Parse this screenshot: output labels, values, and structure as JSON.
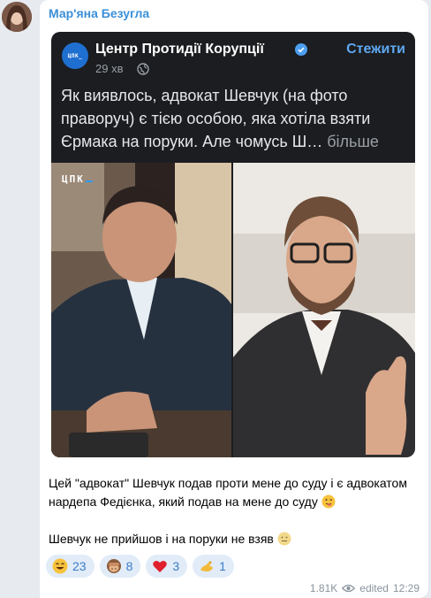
{
  "message": {
    "sender": "Мар'яна Безугла",
    "text_line1": "Цей \"адвокат\" Шевчук подав проти мене до суду і є адвокатом нардепа Федієнка, який подав на мене до суду",
    "text_line2": "Шевчук не прийшов і на поруки не взяв",
    "views": "1.81K",
    "edited_label": "edited",
    "time": "12:29"
  },
  "forward": {
    "channel_name": "Центр Протидії Корупції",
    "logo_text": "ЦПК_",
    "follow_label": "Стежити",
    "posted_ago": "29 хв",
    "post_text": "Як виявлось, адвокат Шевчук (на фото праворуч) є тією особою, яка хотіла взяти Єрмака на поруки. Але чомусь Ш…",
    "more_label": "більше",
    "photo_watermark": "ЦПК"
  },
  "reactions": [
    {
      "emoji": "grinning-face",
      "count": "23"
    },
    {
      "emoji": "see-no-evil-monkey",
      "count": "8"
    },
    {
      "emoji": "red-heart",
      "count": "3"
    },
    {
      "emoji": "pinched-fingers",
      "count": "1"
    }
  ],
  "colors": {
    "accent": "#3a8fd8",
    "card_bg": "#1b1d20",
    "reaction_bg": "#e1ecf8"
  }
}
